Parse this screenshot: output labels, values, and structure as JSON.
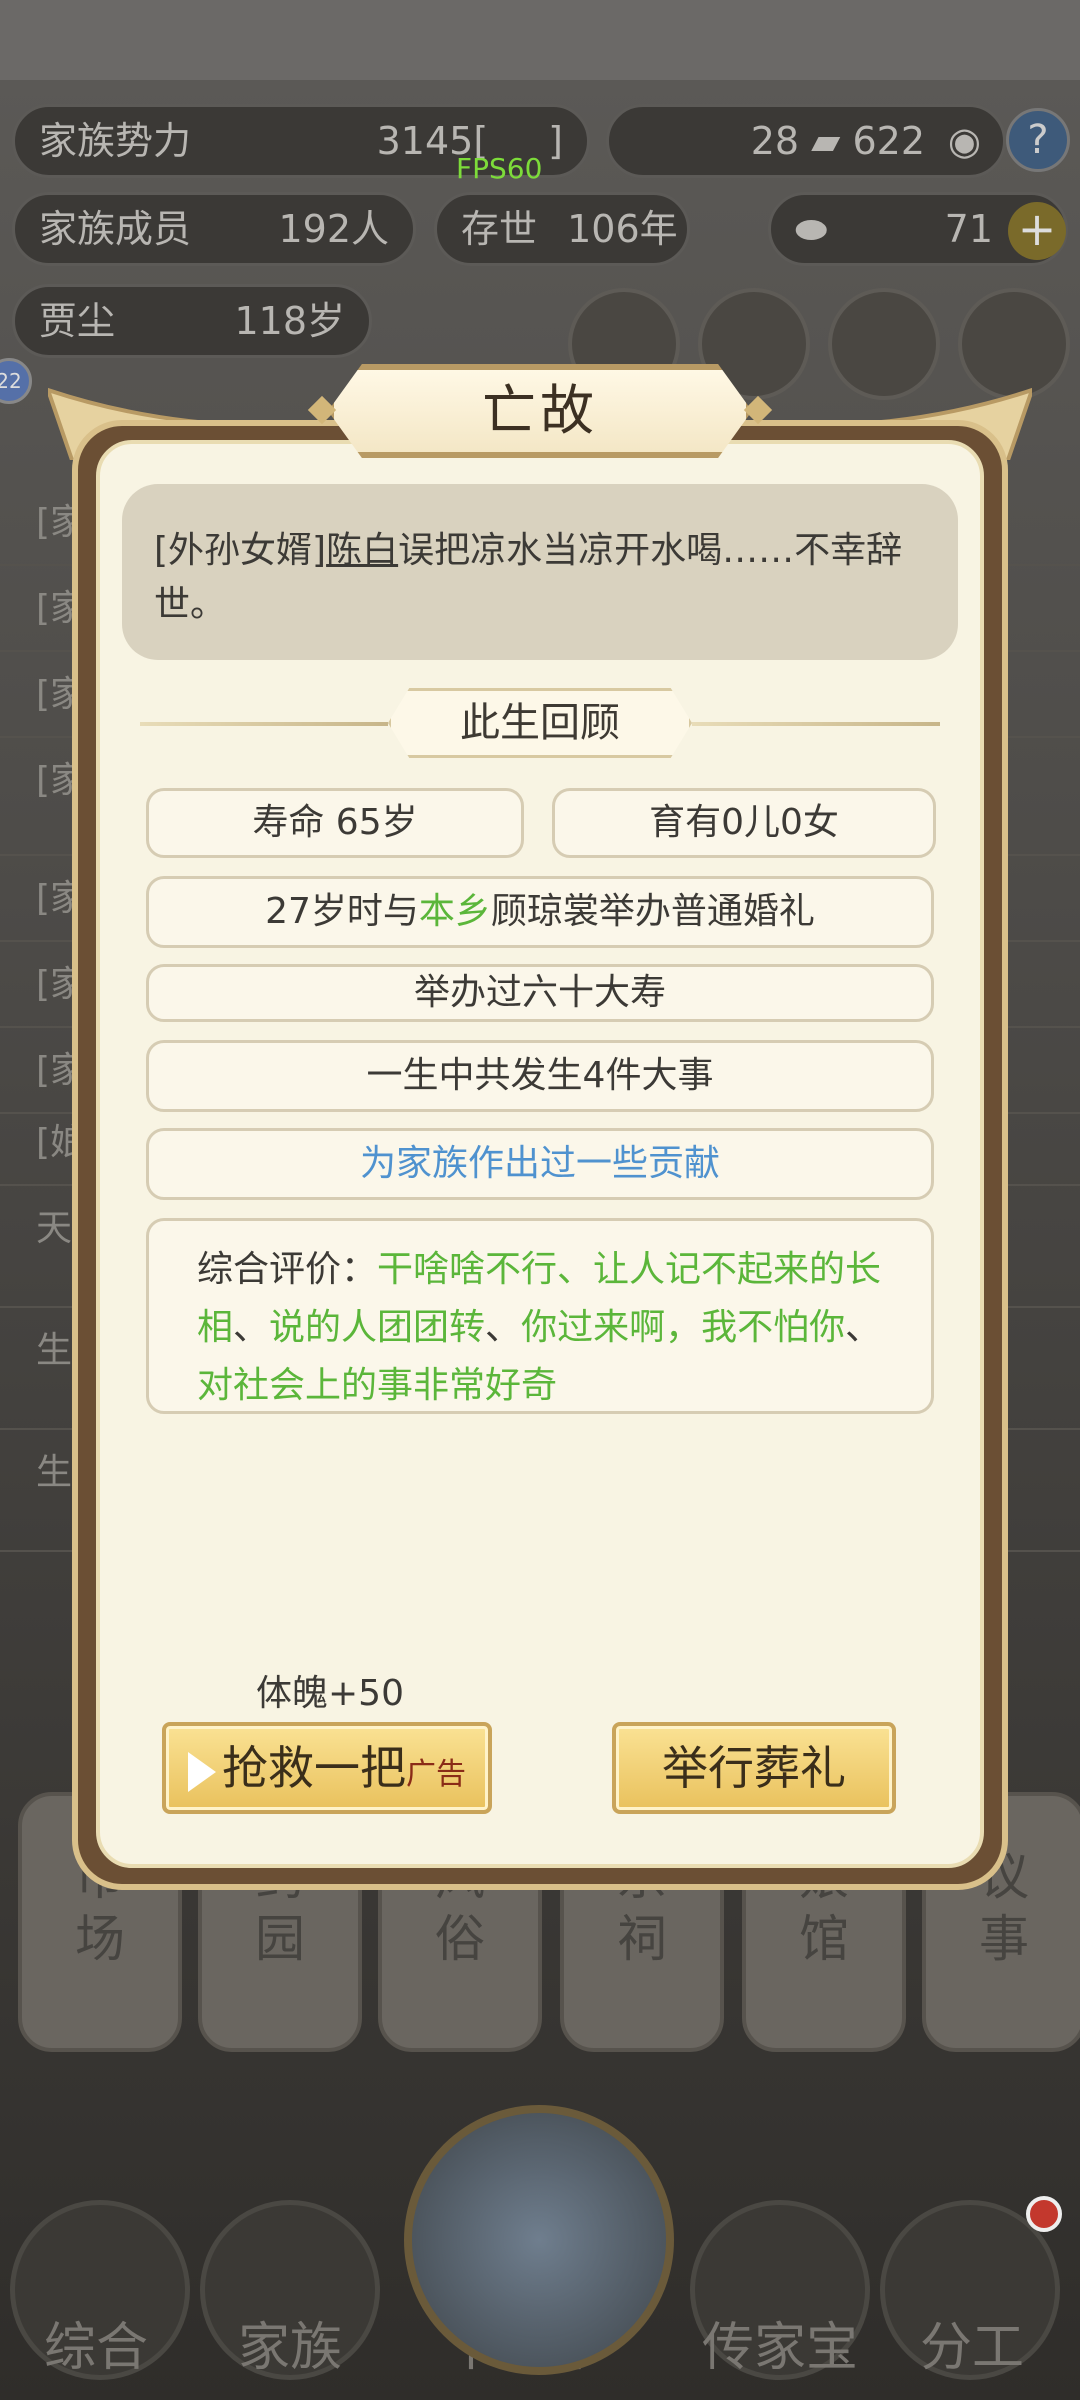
{
  "hud": {
    "clan_power_label": "家族势力",
    "clan_power_value": "3145",
    "clan_power_bracket_open": "[",
    "clan_power_bracket_close": "]",
    "fps": "FPS60",
    "silver": "28",
    "copper": "622",
    "members_label": "家族成员",
    "members_value": "192人",
    "years_label": "存世",
    "years_value": "106年",
    "gold_value": "71",
    "elder_name": "贾尘",
    "elder_age": "118岁",
    "badge": "22"
  },
  "background_rows": [
    "[家",
    "[家",
    "[家",
    "[家",
    "[家",
    "[家",
    "[家",
    "[娘",
    "天",
    "生",
    "生"
  ],
  "buildings": [
    "市场",
    "药园",
    "风俗",
    "宗祠",
    "娘馆",
    "议事"
  ],
  "nav": {
    "items": [
      "综合",
      "家族",
      "下一年",
      "传家宝",
      "分工"
    ]
  },
  "modal": {
    "title": "亡故",
    "message_prefix": "[外孙女婿]",
    "message_name": "陈白",
    "message_rest": "误把凉水当凉开水喝……不幸辞世。",
    "section_title": "此生回顾",
    "lifespan": "寿命 65岁",
    "children": "育有0儿0女",
    "marriage_prefix": "27岁时与",
    "marriage_place": "本乡",
    "marriage_rest": "顾琼裳举办普通婚礼",
    "birthday": "举办过六十大寿",
    "events": "一生中共发生4件大事",
    "contribution": "为家族作出过一些贡献",
    "eval_label": "综合评价：",
    "eval_t1": "干啥啥不行、让人记不起来的长相",
    "eval_s1": "、",
    "eval_t2": "说的人团团转",
    "eval_s2": "、",
    "eval_t3": "你过来啊，我不怕你",
    "eval_s3": "、",
    "eval_t4": "对社会上的事非常好奇",
    "reward": "体魄+50",
    "rescue_button": "抢救一把",
    "ad_label": "广告",
    "funeral_button": "举行葬礼"
  },
  "colors": {
    "highlight_green": "#5bb63a",
    "highlight_blue": "#4f92cf",
    "button_gold": "#e9c15c"
  }
}
